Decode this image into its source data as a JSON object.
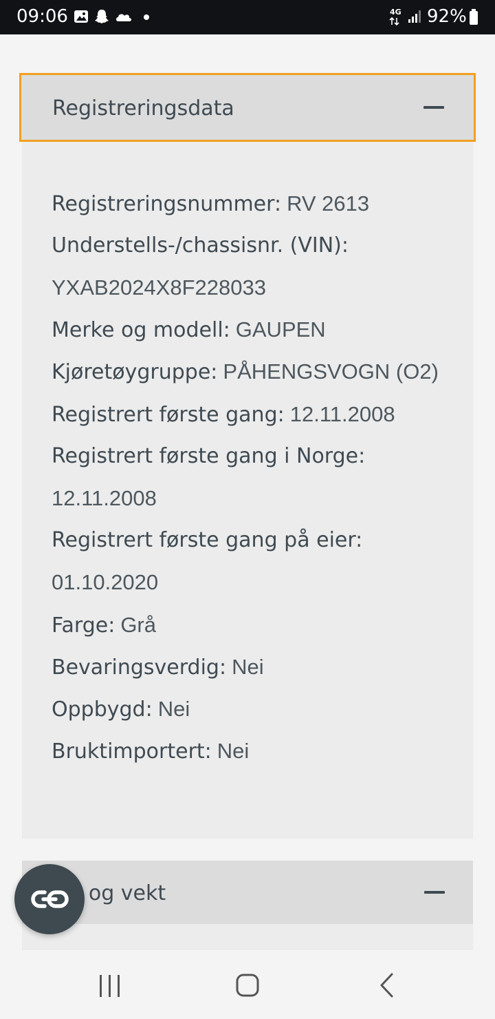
{
  "status_bar": {
    "time": "09:06",
    "network": "4G",
    "battery": "92%"
  },
  "section1": {
    "title": "Registreringsdata",
    "rows": [
      {
        "label": "Registreringsnummer:",
        "value": "RV 2613"
      },
      {
        "label": "Understells-/chassisnr. (VIN):",
        "value": ""
      },
      {
        "label": "",
        "value": "YXAB2024X8F228033"
      },
      {
        "label": "Merke og modell:",
        "value": "GAUPEN"
      },
      {
        "label": "Kjøretøygruppe:",
        "value": "PÅHENGSVOGN (O2)"
      },
      {
        "label": "Registrert første gang:",
        "value": "12.11.2008"
      },
      {
        "label": "Registrert første gang i Norge:",
        "value": ""
      },
      {
        "label": "",
        "value": "12.11.2008"
      },
      {
        "label": "Registrert første gang på eier:",
        "value": ""
      },
      {
        "label": "",
        "value": "01.10.2020"
      },
      {
        "label": "Farge:",
        "value": "Grå"
      },
      {
        "label": "Bevaringsverdig:",
        "value": "Nei"
      },
      {
        "label": "Oppbygd:",
        "value": "Nei"
      },
      {
        "label": "Bruktimportert:",
        "value": "Nei"
      }
    ]
  },
  "section2": {
    "title_visible": "l og vekt"
  },
  "icons": {
    "fab": "link-icon",
    "nav": [
      "recent-apps-icon",
      "home-icon",
      "back-icon"
    ],
    "collapse": "minus-icon"
  },
  "colors": {
    "focus_border": "#f0a020",
    "header_bg": "#dcdcdc",
    "panel_bg": "#ececec",
    "fab_bg": "#3e4a50"
  }
}
